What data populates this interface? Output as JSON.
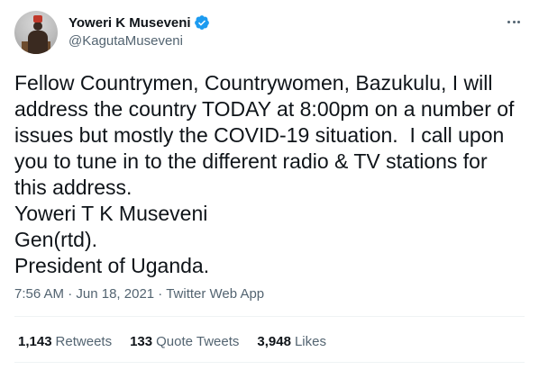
{
  "author": {
    "display_name": "Yoweri K Museveni",
    "handle": "@KagutaMuseveni",
    "verified_icon": "verified-badge-icon",
    "verified_color": "#1d9bf0"
  },
  "tweet": {
    "lines": [
      "Fellow Countrymen, Countrywomen, Bazukulu, I will",
      "address the country TODAY at 8:00pm on a number of",
      "issues but mostly the COVID-19 situation.  I call upon",
      "you to tune in to the different radio & TV stations for",
      "this address.",
      "Yoweri T K Museveni",
      "Gen(rtd).",
      "President of Uganda."
    ]
  },
  "meta": {
    "time": "7:56 AM",
    "separator": " · ",
    "date": "Jun 18, 2021",
    "source": "Twitter Web App"
  },
  "stats": {
    "retweets_count": "1,143",
    "retweets_label": "Retweets",
    "quotes_count": "133",
    "quotes_label": "Quote Tweets",
    "likes_count": "3,948",
    "likes_label": "Likes"
  }
}
